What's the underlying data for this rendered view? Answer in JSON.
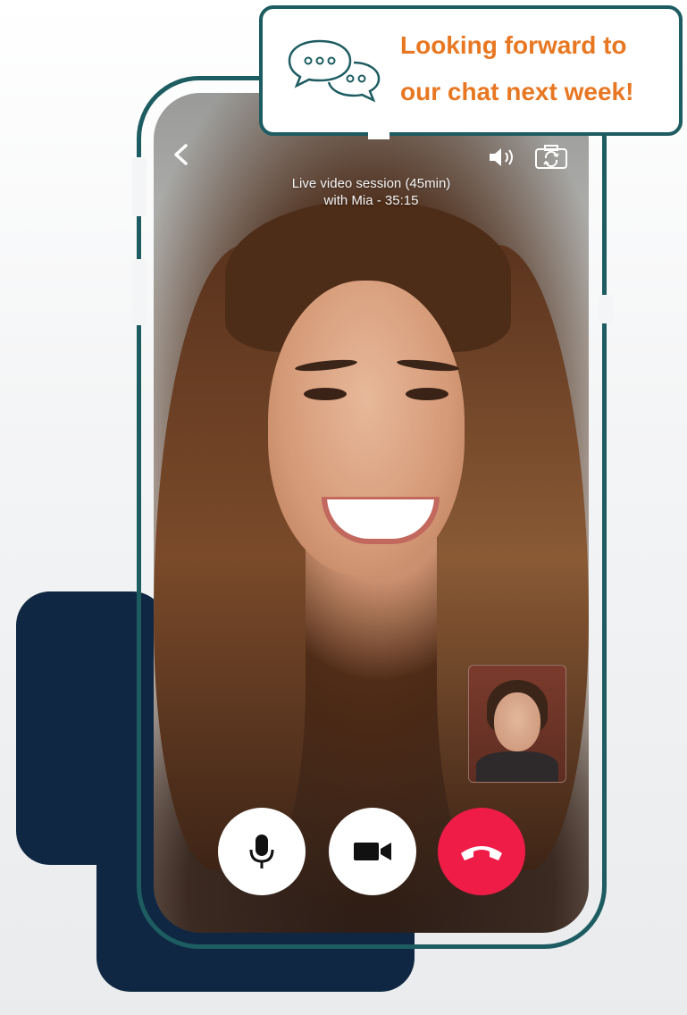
{
  "bubble": {
    "line1": "Looking forward to",
    "line2": "our chat next week!",
    "text_color": "#e87722",
    "border_color": "#1d5c61"
  },
  "call": {
    "session_line1": "Live video session (45min)",
    "session_line2": "with Mia - 35:15"
  },
  "icons": {
    "back": "chevron-left-icon",
    "speaker": "speaker-icon",
    "camera_switch": "camera-switch-icon",
    "mic": "microphone-icon",
    "video": "video-camera-icon",
    "end_call": "phone-hangup-icon",
    "chat": "chat-bubbles-icon"
  },
  "colors": {
    "navy": "#0f2742",
    "frame": "#1d5c61",
    "end_call": "#ef1c48"
  }
}
